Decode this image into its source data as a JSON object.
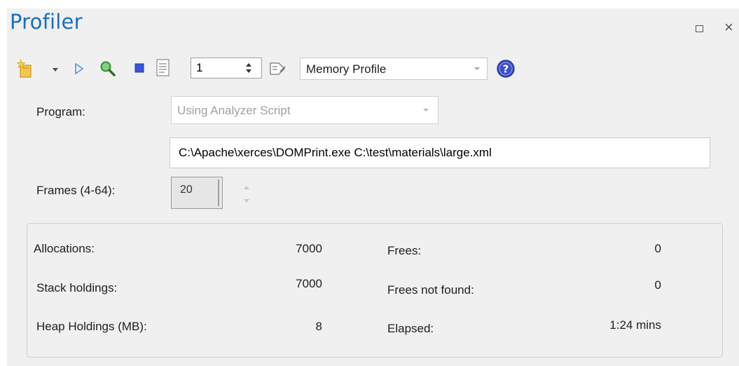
{
  "window": {
    "title": "Profiler",
    "maximize_icon": "maximize-icon",
    "close_symbol": "×"
  },
  "toolbar": {
    "icons": [
      "new-session-icon",
      "dropdown-arrow-icon",
      "play-icon",
      "search-icon",
      "stop-icon",
      "report-icon",
      "marker-icon",
      "help-icon"
    ],
    "threads_value": "1",
    "profile_type": "Memory Profile"
  },
  "form": {
    "program_label": "Program:",
    "program_value": "Using Analyzer Script",
    "command_line": "C:\\Apache\\xerces\\DOMPrint.exe C:\\test\\materials\\large.xml",
    "frames_label": "Frames (4-64):",
    "frames_value": "20"
  },
  "stats": {
    "allocations_label": "Allocations:",
    "allocations_value": "7000",
    "stack_label": "Stack holdings:",
    "stack_value": "7000",
    "heap_label": "Heap Holdings (MB):",
    "heap_value": "8",
    "frees_label": "Frees:",
    "frees_value": "0",
    "frees_not_found_label": "Frees not found:",
    "frees_not_found_value": "0",
    "elapsed_label": "Elapsed:",
    "elapsed_value": "1:24 mins"
  },
  "colors": {
    "title": "#1a6fc0",
    "panel_bg": "#f0f0f0",
    "help_icon": "#3b4fc8"
  }
}
